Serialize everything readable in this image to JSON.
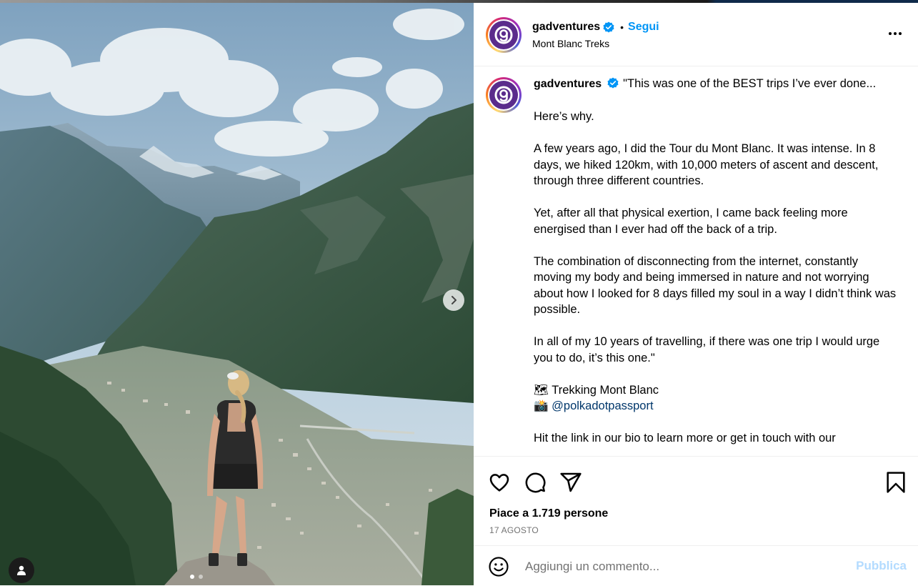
{
  "post": {
    "username": "gadventures",
    "follow_label": "Segui",
    "bullet": "•",
    "location": "Mont Blanc Treks",
    "caption": {
      "first_line": "\"This was one of the BEST trips I’ve ever done...",
      "p1": "Here’s why.",
      "p2": "A few years ago, I did the Tour du Mont Blanc. It was intense. In 8 days, we hiked 120km, with 10,000 meters of ascent and descent, through three different countries.",
      "p3": "Yet, after all that physical exertion, I came back feeling more energised than I ever had off the back of a trip.",
      "p4": "The combination of disconnecting from the internet, constantly moving my body and being immersed in nature and not worrying about how I looked for 8 days filled my soul in a way I didn’t think was possible.",
      "p5": "In all of my 10 years of travelling, if there was one trip I would urge you to do, it’s this one.\"",
      "trek_emoji": "🗺",
      "trek_label": "Trekking Mont Blanc",
      "camera_emoji": "📸",
      "mention": "@polkadotpassport",
      "p7": "Hit the link in our bio to learn more or get in touch with our"
    },
    "likes_text": "Piace a 1.719 persone",
    "date": "17 AGOSTO",
    "comment_placeholder": "Aggiungi un commento...",
    "publish_label": "Pubblica"
  },
  "carousel": {
    "dot_count": 2,
    "active_index": 0
  },
  "icons": {
    "header_more": "more-options-icon",
    "verified": "verified-badge-icon",
    "like": "heart-icon",
    "comment": "comment-icon",
    "share": "share-icon",
    "save": "bookmark-icon",
    "emoji": "emoji-icon",
    "next": "chevron-right-icon",
    "tagged_user": "user-icon"
  },
  "colors": {
    "follow": "#0095f6",
    "publish_disabled": "#b3dbff",
    "verified": "#0095f6",
    "mention": "#00376b"
  }
}
